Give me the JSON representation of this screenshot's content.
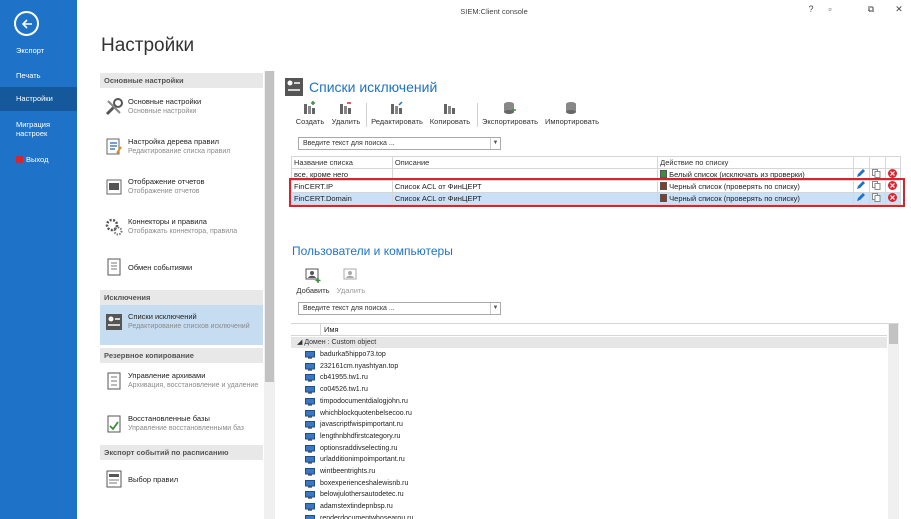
{
  "window": {
    "title": "SIEM:Client console",
    "controls": [
      "?",
      "▫",
      "⧉",
      "✕"
    ]
  },
  "nav": {
    "items": [
      {
        "label": "Экспорт"
      },
      {
        "label": "Печать"
      },
      {
        "label": "Настройки",
        "active": true
      },
      {
        "label": "Миграция настроек",
        "label_line1": "Миграция",
        "label_line2": "настроек"
      },
      {
        "label": "Выход"
      }
    ]
  },
  "page_title": "Настройки",
  "settings": {
    "sections": {
      "main": "Основные настройки",
      "exceptions": "Исключения",
      "backup": "Резервное копирование",
      "export_schedule": "Экспорт событий по расписанию"
    },
    "items": [
      {
        "title": "Основные настройки",
        "subtitle": "Основные настройки"
      },
      {
        "title": "Настройка дерева правил",
        "subtitle": "Редактирование списка правил"
      },
      {
        "title": "Отображение отчетов",
        "subtitle": "Отображение отчетов"
      },
      {
        "title": "Коннекторы и правила",
        "subtitle": "Отображать коннектора, правила"
      },
      {
        "title": "Обмен событиями",
        "subtitle": ""
      },
      {
        "title": "Списки исключений",
        "subtitle": "Редактирование списков исключений",
        "active": true
      },
      {
        "title": "Управление архивами",
        "subtitle": "Архивация, восстановление и удаление"
      },
      {
        "title": "Восстановленные базы",
        "subtitle": "Управление восстановленными баз"
      },
      {
        "title": "Выбор правил",
        "subtitle": ""
      }
    ]
  },
  "exceptions": {
    "title": "Списки исключений",
    "toolbar": {
      "create": "Создать",
      "delete": "Удалить",
      "edit": "Редактировать",
      "copy": "Копировать",
      "export": "Экспортировать",
      "import": "Импортировать"
    },
    "search_placeholder": "Введите текст для поиска ...",
    "columns": [
      "Название списка",
      "Описание",
      "Действие по списку"
    ],
    "rows": [
      {
        "name": "все, кроме него",
        "description": "",
        "action": "Белый список (исключать из проверки)",
        "action_color": "#3a8f3a"
      },
      {
        "name": "FinCERT.IP",
        "description": "Список ACL от ФинЦЕРТ",
        "action": "Черный список (проверять по списку)",
        "action_color": "#8a3a2a"
      },
      {
        "name": "FinCERT.Domain",
        "description": "Список ACL от ФинЦЕРТ",
        "action": "Черный список (проверять по списку)",
        "action_color": "#8a3a2a",
        "selected": true
      }
    ]
  },
  "users": {
    "title": "Пользователи и компьютеры",
    "toolbar": {
      "add": "Добавить",
      "delete": "Удалить"
    },
    "search_placeholder": "Введите текст для поиска ...",
    "column": "Имя",
    "group": "Домен : Custom object",
    "items": [
      "badurka5hippo73.top",
      "232161cm.nyashtyan.top",
      "cb41955.tw1.ru",
      "co04526.tw1.ru",
      "timpodocumentdialogjohn.ru",
      "whichblockquotenbelsecoo.ru",
      "javascriptfwispimportant.ru",
      "lengthnbhdfirstcategory.ru",
      "optionsraddivselecting.ru",
      "urladditionimpoimportant.ru",
      "wintbeentrights.ru",
      "boxexperienceshalewisnb.ru",
      "belowjulothersautodetec.ru",
      "adamstextindepnbsp.ru",
      "renderdocumentwhosearou.ru"
    ]
  },
  "colors": {
    "nav_blue": "#1e73c8",
    "nav_active": "#15589c",
    "accent": "#1e73c8",
    "highlight_frame": "#d9232d",
    "selected_row": "#c9e0f7",
    "delete_red": "#d9232d"
  }
}
